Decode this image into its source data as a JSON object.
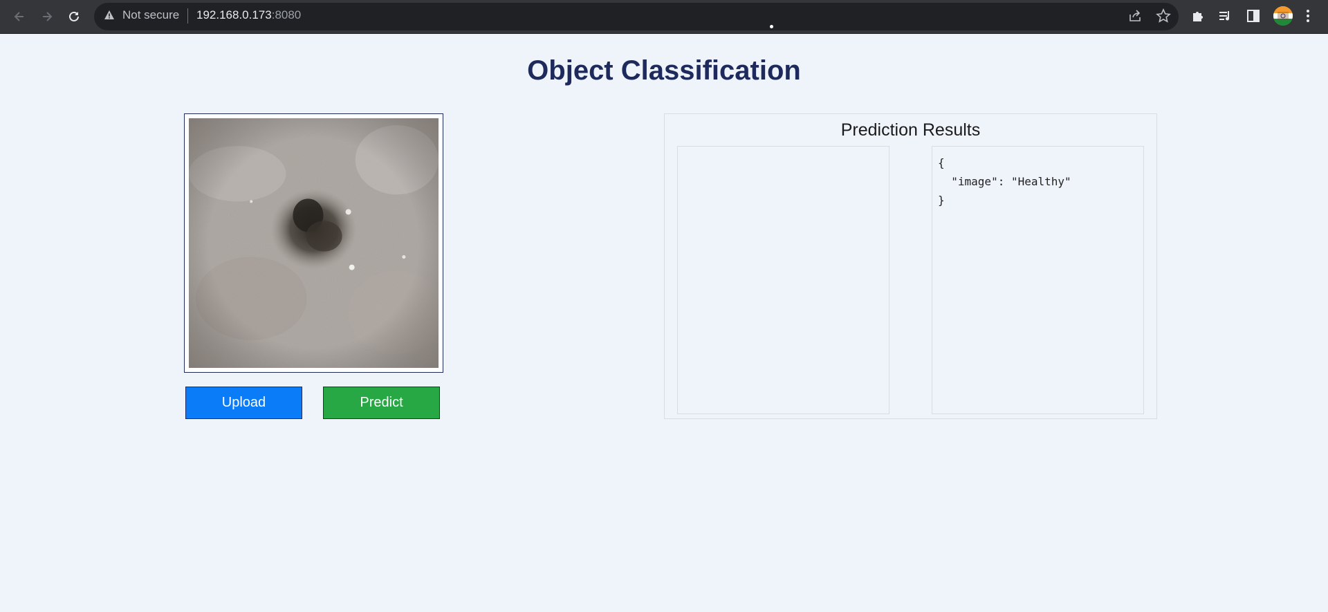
{
  "browser": {
    "security_label": "Not secure",
    "url_host": "192.168.0.173",
    "url_port": ":8080"
  },
  "page": {
    "title": "Object Classification",
    "upload_label": "Upload",
    "predict_label": "Predict"
  },
  "results": {
    "title": "Prediction Results",
    "json_lines": [
      "{",
      "  \"image\": \"Healthy\"",
      "}"
    ]
  }
}
